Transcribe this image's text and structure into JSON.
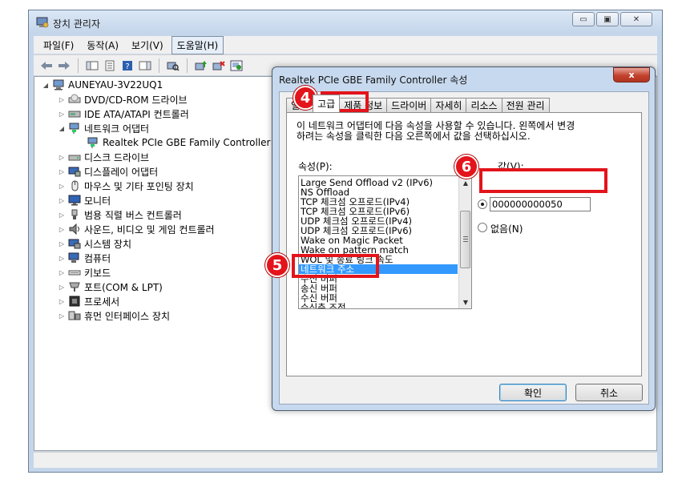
{
  "window": {
    "title": "장치 관리자",
    "controls": [
      "▭",
      "▣",
      "✕"
    ]
  },
  "menu": {
    "items": [
      "파일(F)",
      "동작(A)",
      "보기(V)",
      "도움말(H)"
    ]
  },
  "tree": {
    "root": "AUNEYAU-3V22UQ1",
    "items": [
      "DVD/CD-ROM 드라이브",
      "IDE ATA/ATAPI 컨트롤러",
      "네트워크 어댑터",
      "Realtek PCIe GBE Family Controller",
      "디스크 드라이브",
      "디스플레이 어댑터",
      "마우스 및 기타 포인팅 장치",
      "모니터",
      "범용 직렬 버스 컨트롤러",
      "사운드, 비디오 및 게임 컨트롤러",
      "시스템 장치",
      "컴퓨터",
      "키보드",
      "포트(COM & LPT)",
      "프로세서",
      "휴먼 인터페이스 장치"
    ]
  },
  "dialog": {
    "title": "Realtek PCIe GBE Family Controller 속성",
    "close_label": "x",
    "tabs": [
      "일반",
      "고급",
      "제품 정보",
      "드라이버",
      "자세히",
      "리소스",
      "전원 관리"
    ],
    "description_line1": "이 네트워크 어댑터에 다음 속성을 사용할 수 있습니다. 왼쪽에서 변경",
    "description_line2": "하려는 속성을 클릭한 다음 오른쪽에서 값을 선택하십시오.",
    "property_label": "속성(P):",
    "value_label": "값(V):",
    "properties": [
      "Large Send Offload v2 (IPv6)",
      "NS Offload",
      "TCP 체크섬 오프로드(IPv4)",
      "TCP 체크섬 오프로드(IPv6)",
      "UDP 체크섬 오프로드(IPv4)",
      "UDP 체크섬 오프로드(IPv6)",
      "Wake on Magic Packet",
      "Wake on pattern match",
      "WOL 및 종료 링크 속도",
      "네트워크 주소",
      "수신 버퍼",
      "송신 버퍼",
      "수신 버퍼",
      "수신측 조정"
    ],
    "value_input": "000000000050",
    "none_option": "없음(N)",
    "ok_label": "확인",
    "cancel_label": "취소"
  },
  "annotations": {
    "step4": "4",
    "step5": "5",
    "step6": "6",
    "color": "#e3141b"
  },
  "colors": {
    "selection": "#3399ff",
    "chrome": "#c5d6ea"
  }
}
